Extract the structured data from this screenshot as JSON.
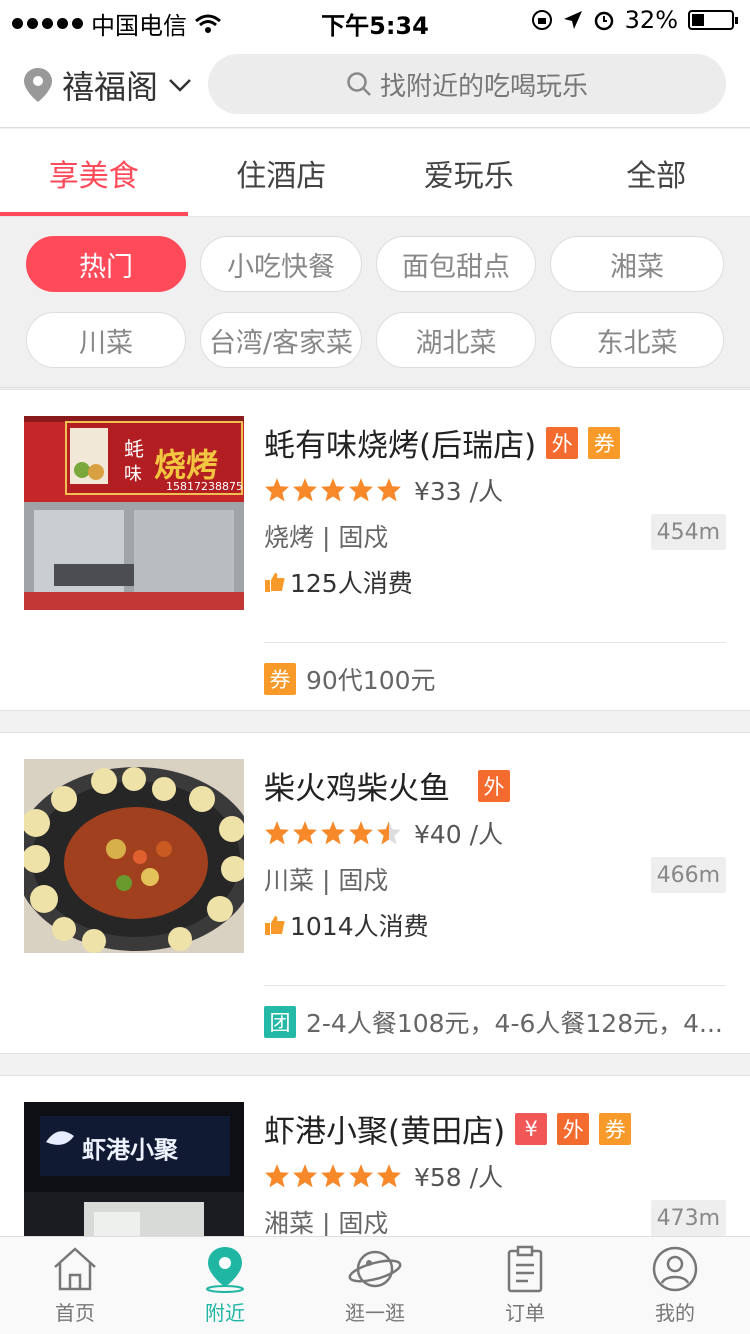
{
  "status_bar": {
    "carrier": "中国电信",
    "time": "下午5:34",
    "battery": "32%"
  },
  "header": {
    "location": "禧福阁",
    "search_placeholder": "找附近的吃喝玩乐"
  },
  "tabs": [
    {
      "label": "享美食",
      "active": true
    },
    {
      "label": "住酒店",
      "active": false
    },
    {
      "label": "爱玩乐",
      "active": false
    },
    {
      "label": "全部",
      "active": false
    }
  ],
  "chips": [
    "热门",
    "小吃快餐",
    "面包甜点",
    "湘菜",
    "川菜",
    "台湾/客家菜",
    "湖北菜",
    "东北菜"
  ],
  "restaurants": [
    {
      "name": "蚝有味烧烤(后瑞店)",
      "tags": [
        "外",
        "券"
      ],
      "rating": 5,
      "price": "¥33 /人",
      "category": "烧烤 | 固戍",
      "distance": "454m",
      "sold": "125人消费",
      "deal_icon": "券",
      "deal": "90代100元",
      "photo_sign": "烧烤",
      "photo_phone": "15817238875"
    },
    {
      "name": "柴火鸡柴火鱼",
      "tags": [
        "外"
      ],
      "rating": 4.5,
      "price": "¥40 /人",
      "category": "川菜 | 固戍",
      "distance": "466m",
      "sold": "1014人消费",
      "deal_icon": "团",
      "deal": "2-4人餐108元，4-6人餐128元，4..."
    },
    {
      "name": "虾港小聚(黄田店)",
      "tags": [
        "¥",
        "外",
        "券"
      ],
      "rating": 5,
      "price": "¥58 /人",
      "category": "湘菜 | 固戍",
      "distance": "473m",
      "photo_sign": "虾港小聚"
    }
  ],
  "bottom_nav": [
    {
      "label": "首页",
      "icon": "home-icon",
      "active": false
    },
    {
      "label": "附近",
      "icon": "location-pin-icon",
      "active": true
    },
    {
      "label": "逛一逛",
      "icon": "planet-icon",
      "active": false
    },
    {
      "label": "订单",
      "icon": "clipboard-icon",
      "active": false
    },
    {
      "label": "我的",
      "icon": "user-icon",
      "active": false
    }
  ],
  "colors": {
    "accent": "#ff4a5a",
    "nav_active": "#20b6a4",
    "star": "#f7892a"
  }
}
